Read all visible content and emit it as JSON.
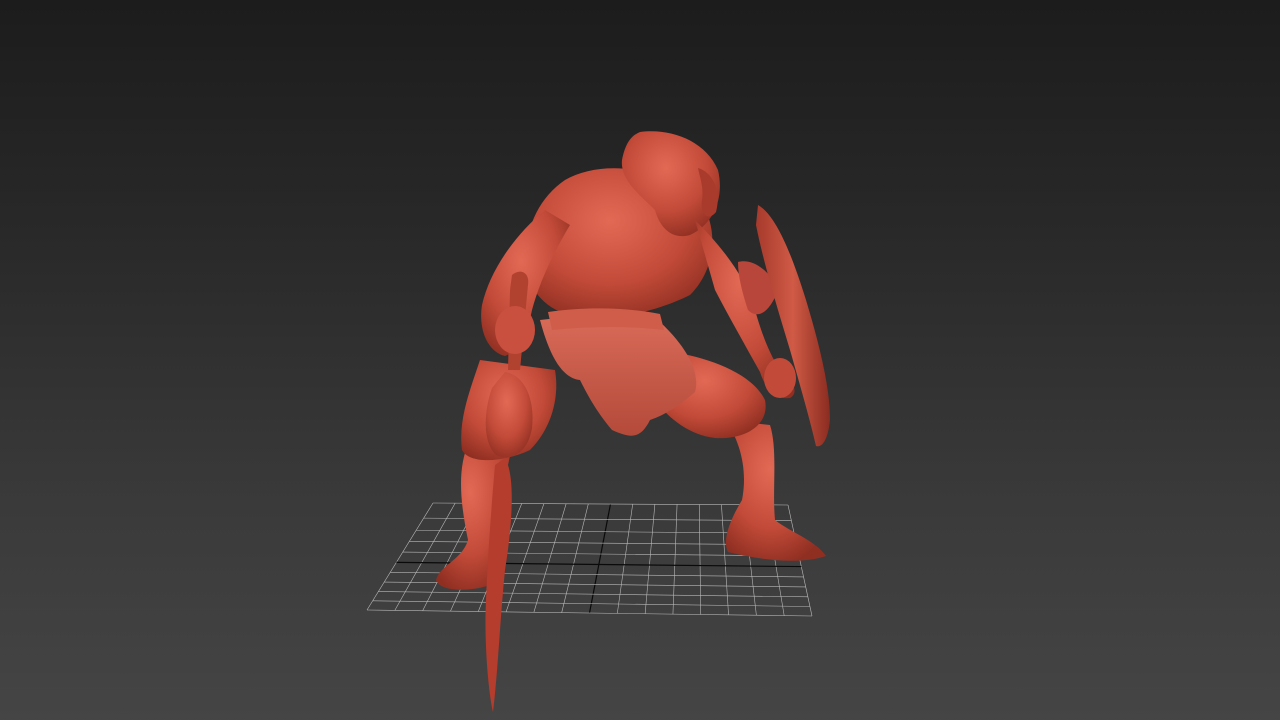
{
  "viewport": {
    "view": "perspective",
    "shading": "smooth",
    "background_top": "#1c1c1c",
    "background_bottom": "#454545"
  },
  "scene": {
    "model": {
      "name": "warrior-character",
      "material_color": "#c9503e",
      "props": [
        "club",
        "shield",
        "sword"
      ]
    },
    "grid": {
      "visible": true,
      "line_color": "#b9b9b9",
      "axis_color": "#0a0a0a"
    }
  }
}
